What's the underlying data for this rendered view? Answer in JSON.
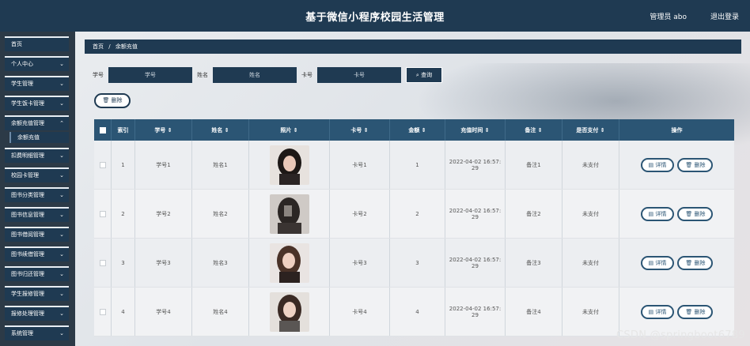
{
  "header": {
    "title": "基于微信小程序校园生活管理",
    "user": "管理员 abo",
    "logout": "退出登录"
  },
  "sidebar": {
    "items": [
      {
        "label": "首页",
        "chevron": false
      },
      {
        "label": "个人中心",
        "chevron": true
      },
      {
        "label": "学生管理",
        "chevron": true
      },
      {
        "label": "学生饭卡管理",
        "chevron": true
      },
      {
        "label": "余额充值管理",
        "chevron": true,
        "sub": "余额充值"
      },
      {
        "label": "扣费明细管理",
        "chevron": true
      },
      {
        "label": "校园卡管理",
        "chevron": true
      },
      {
        "label": "图书分类管理",
        "chevron": true
      },
      {
        "label": "图书信息管理",
        "chevron": true
      },
      {
        "label": "图书借阅管理",
        "chevron": true
      },
      {
        "label": "图书续借管理",
        "chevron": true
      },
      {
        "label": "图书归还管理",
        "chevron": true
      },
      {
        "label": "学生报修管理",
        "chevron": true
      },
      {
        "label": "报修处理管理",
        "chevron": true
      },
      {
        "label": "系统管理",
        "chevron": true
      }
    ]
  },
  "breadcrumb": {
    "home": "首页",
    "sep": "/",
    "current": "余额充值"
  },
  "search": {
    "label_student_no": "学号",
    "placeholder_student_no": "学号",
    "label_name": "姓名",
    "placeholder_name": "姓名",
    "label_card": "卡号",
    "placeholder_card": "卡号",
    "query_label": "查询",
    "delete_label": "删除"
  },
  "table": {
    "headers": [
      "",
      "索引",
      "学号",
      "姓名",
      "照片",
      "卡号",
      "金额",
      "充值时间",
      "备注",
      "是否支付",
      "操作"
    ],
    "sortable": [
      false,
      false,
      true,
      true,
      true,
      true,
      true,
      true,
      true,
      true,
      false
    ],
    "rows": [
      {
        "index": "1",
        "student_no": "学号1",
        "name": "姓名1",
        "card": "卡号1",
        "amount": "1",
        "time_line1": "2022-04-02 16:57:",
        "time_line2": "29",
        "remark": "备注1",
        "paid": "未支付"
      },
      {
        "index": "2",
        "student_no": "学号2",
        "name": "姓名2",
        "card": "卡号2",
        "amount": "2",
        "time_line1": "2022-04-02 16:57:",
        "time_line2": "29",
        "remark": "备注2",
        "paid": "未支付"
      },
      {
        "index": "3",
        "student_no": "学号3",
        "name": "姓名3",
        "card": "卡号3",
        "amount": "3",
        "time_line1": "2022-04-02 16:57:",
        "time_line2": "29",
        "remark": "备注3",
        "paid": "未支付"
      },
      {
        "index": "4",
        "student_no": "学号4",
        "name": "姓名4",
        "card": "卡号4",
        "amount": "4",
        "time_line1": "2022-04-02 16:57:",
        "time_line2": "29",
        "remark": "备注4",
        "paid": "未支付"
      }
    ],
    "detail_label": "详情",
    "delete_label": "删除"
  },
  "watermark": "CSDN @springboot6789",
  "colors": {
    "primary": "#1f3a52",
    "table_header": "#2b5574",
    "background": "#e9ecef"
  }
}
